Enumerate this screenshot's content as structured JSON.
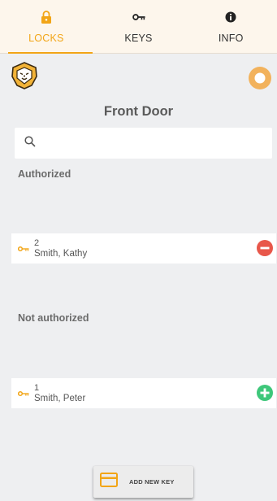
{
  "tabs": [
    {
      "label": "LOCKS",
      "icon": "lock-icon",
      "active": true
    },
    {
      "label": "KEYS",
      "icon": "key-icon",
      "active": false
    },
    {
      "label": "INFO",
      "icon": "info-icon",
      "active": false
    }
  ],
  "lock": {
    "title": "Front Door",
    "status_color": "#f2b25c"
  },
  "search": {
    "placeholder": "",
    "value": ""
  },
  "authorized": {
    "header": "Authorized",
    "items": [
      {
        "id": "2",
        "name": "Smith, Kathy",
        "action": "remove-icon"
      }
    ]
  },
  "not_authorized": {
    "header": "Not authorized",
    "items": [
      {
        "id": "1",
        "name": "Smith, Peter",
        "action": "add-icon"
      }
    ]
  },
  "add_key_button": {
    "label": "ADD NEW KEY",
    "icon": "card-icon"
  },
  "colors": {
    "accent": "#f2a516",
    "remove": "#e8574a",
    "add": "#3ec77a",
    "background": "#eeeff1",
    "tabbar": "#fdf6ec"
  }
}
